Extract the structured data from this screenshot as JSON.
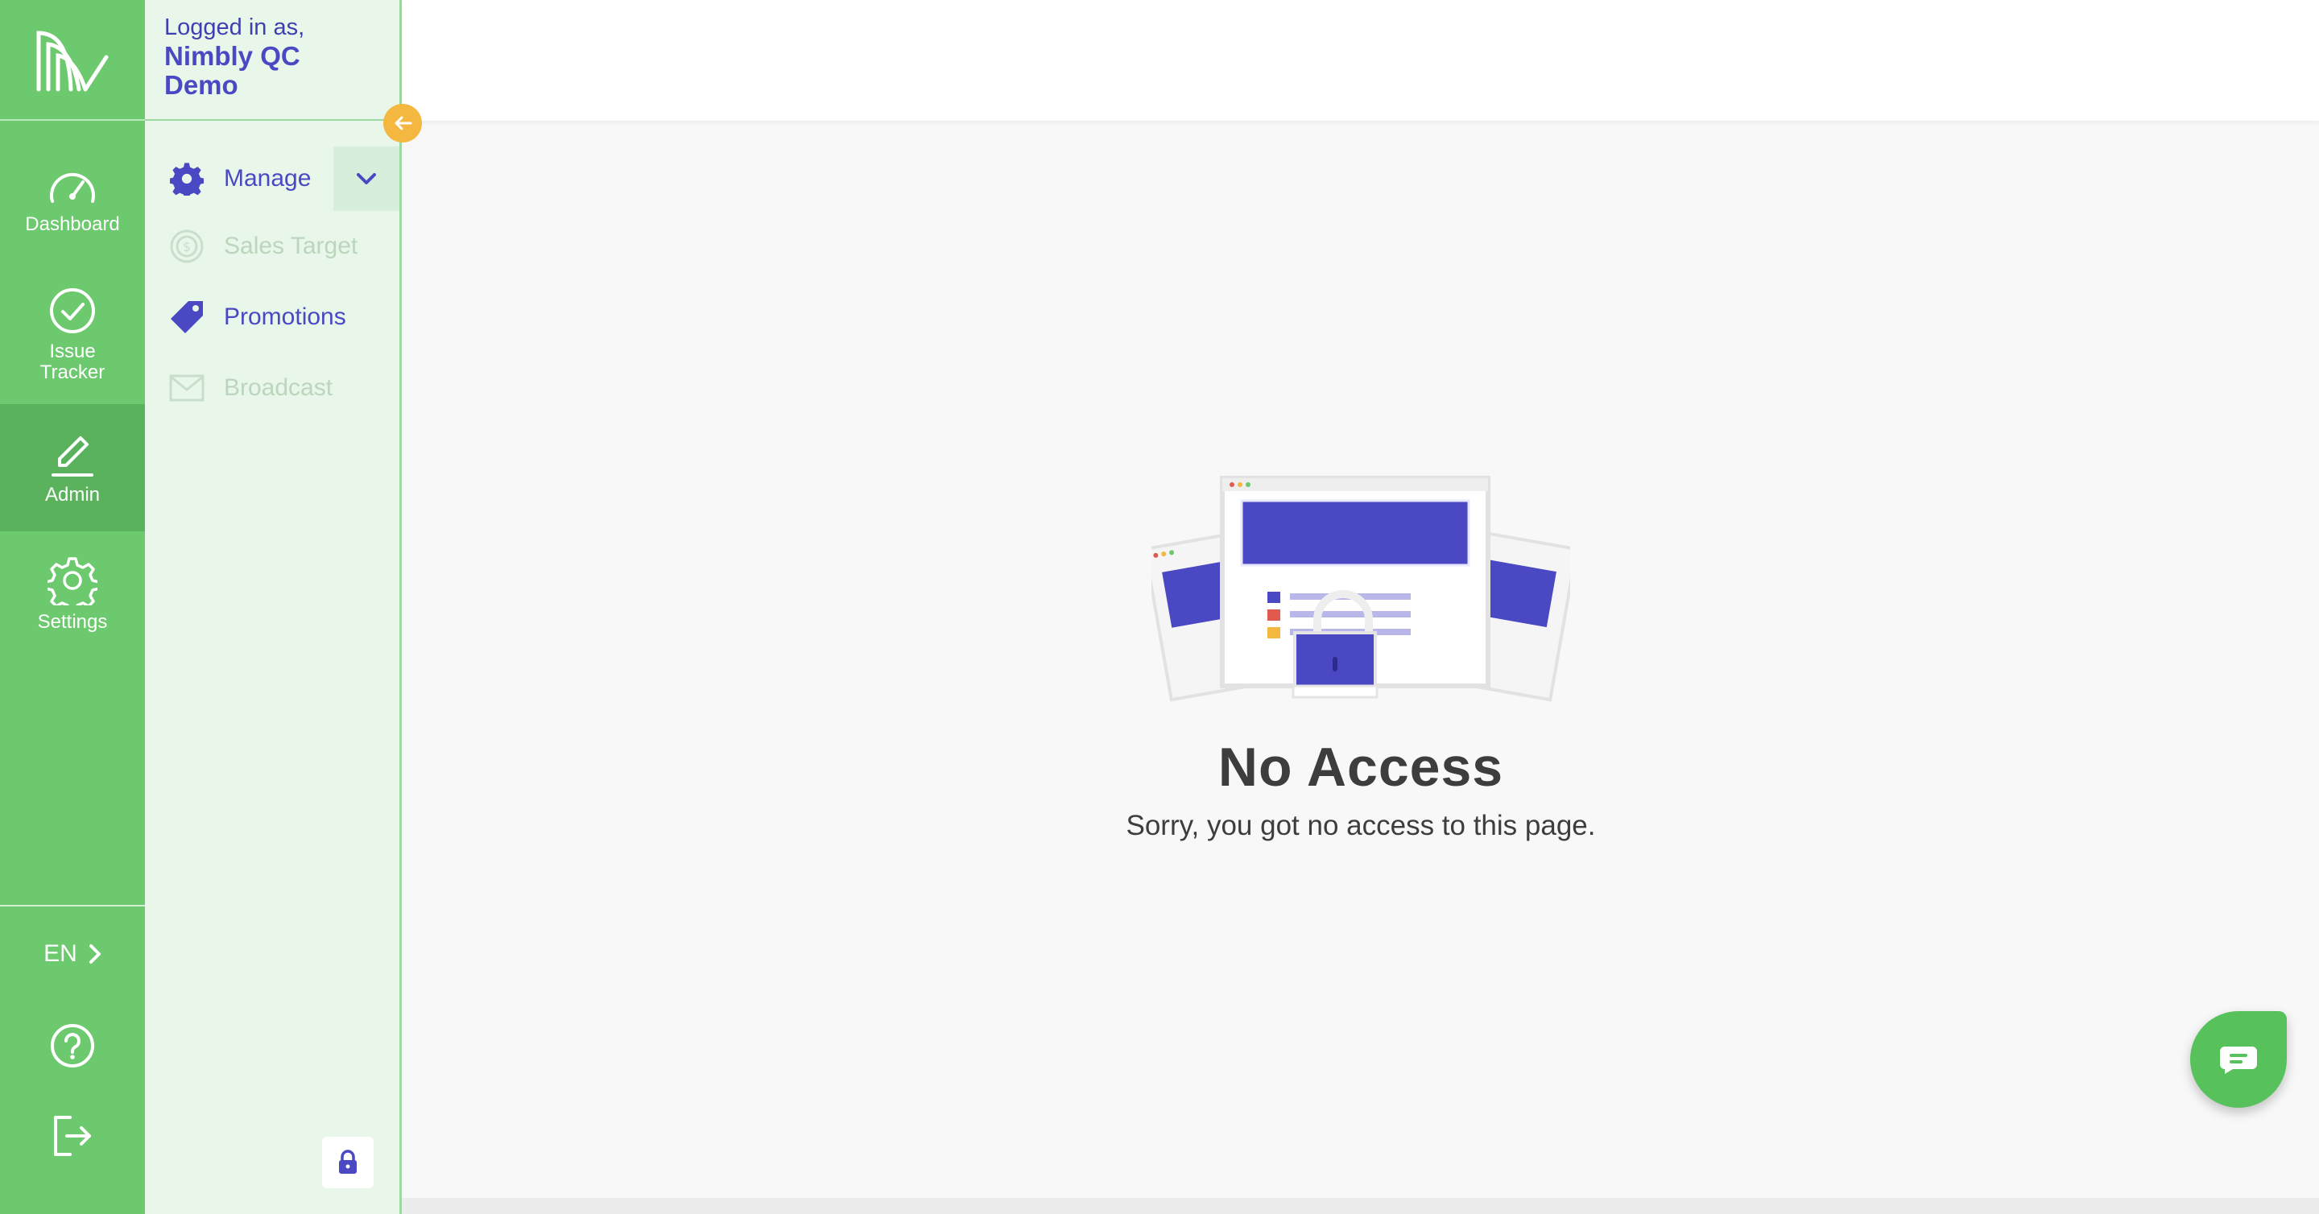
{
  "user": {
    "prefix": "Logged in as,",
    "name": "Nimbly QC Demo"
  },
  "rail": {
    "items": [
      {
        "label": "Dashboard",
        "icon": "speedometer-icon"
      },
      {
        "label": "Issue Tracker",
        "icon": "check-circle-icon"
      },
      {
        "label": "Admin",
        "icon": "pencil-icon"
      },
      {
        "label": "Settings",
        "icon": "gear-icon"
      }
    ],
    "language": "EN"
  },
  "menu": {
    "items": [
      {
        "label": "Manage",
        "icon": "gear-icon",
        "enabled": true
      },
      {
        "label": "Sales Target",
        "icon": "dollar-target-icon",
        "enabled": false
      },
      {
        "label": "Promotions",
        "icon": "tag-icon",
        "enabled": true
      },
      {
        "label": "Broadcast",
        "icon": "envelope-icon",
        "enabled": false
      }
    ]
  },
  "main": {
    "title": "No Access",
    "message": "Sorry, you got no access to this page."
  },
  "colors": {
    "brand_green": "#6cc96e",
    "accent_purple": "#4a48c2",
    "collapse_orange": "#f4b73f"
  }
}
